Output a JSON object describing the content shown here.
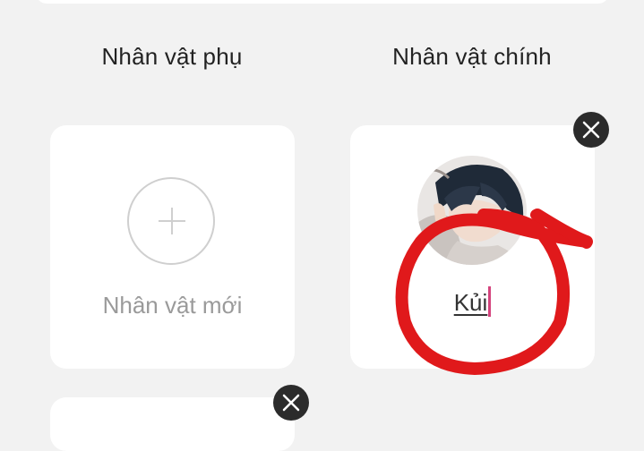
{
  "columns": {
    "supporting_title": "Nhân vật phụ",
    "main_title": "Nhân vật chính"
  },
  "new_character": {
    "label": "Nhân vật mới",
    "icon": "plus-icon"
  },
  "main_character": {
    "name": "Kủi",
    "avatar_icon": "anime-avatar-image"
  },
  "icons": {
    "close": "close-icon"
  },
  "colors": {
    "background": "#f2f2f2",
    "card": "#ffffff",
    "caret": "#d4447d",
    "annotation": "#e0191b"
  }
}
